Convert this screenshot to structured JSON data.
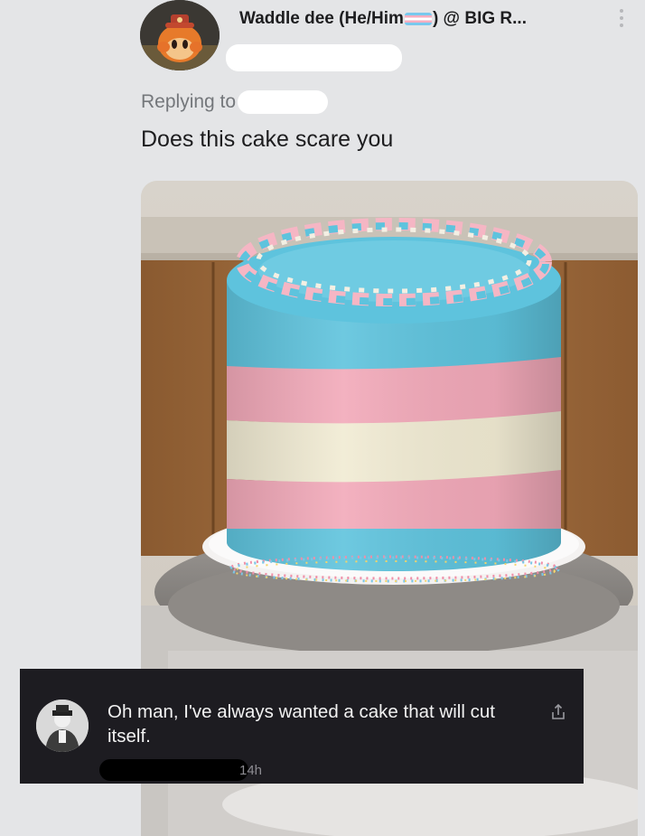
{
  "post": {
    "display_name_part1": "Waddle dee (He/Him",
    "display_name_part2": ") @ BIG R...",
    "flag_emoji": "transgender-flag",
    "replying_label": "Replying to",
    "text": "Does this cake scare you"
  },
  "media": {
    "subject": "trans-flag-cake",
    "stripe_colors": [
      "#5ec3dd",
      "#f2a9b9",
      "#f2ecd6",
      "#f2a9b9",
      "#5ec3dd"
    ]
  },
  "comment": {
    "text": "Oh man, I've always wanted a cake that will cut itself.",
    "time": "14h"
  },
  "colors": {
    "background": "#e4e5e7",
    "overlay": "#1d1c21",
    "muted_text": "#74777b"
  }
}
